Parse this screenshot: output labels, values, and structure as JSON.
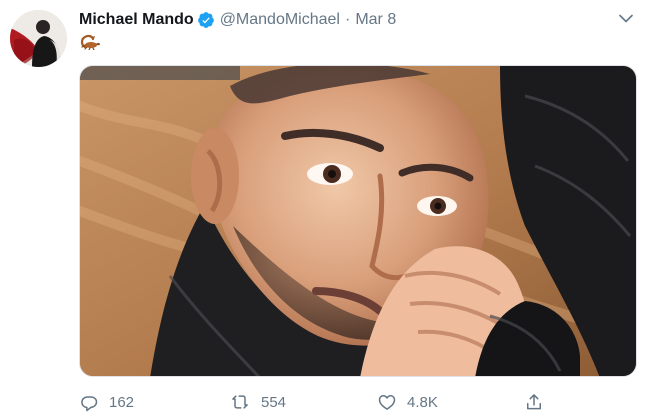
{
  "tweet": {
    "author": {
      "display_name": "Michael Mando",
      "handle": "@MandoMichael",
      "verified": true
    },
    "separator": "·",
    "date": "Mar 8",
    "text_icon": "scorpion-emoji",
    "actions": {
      "reply": {
        "icon": "reply-icon",
        "count": "162"
      },
      "retweet": {
        "icon": "retweet-icon",
        "count": "554"
      },
      "like": {
        "icon": "like-icon",
        "count": "4.8K"
      },
      "share": {
        "icon": "share-icon"
      }
    },
    "colors": {
      "accent": "#1da1f2",
      "name": "#14171a",
      "muted": "#657786",
      "border": "#dfe3e8"
    }
  }
}
